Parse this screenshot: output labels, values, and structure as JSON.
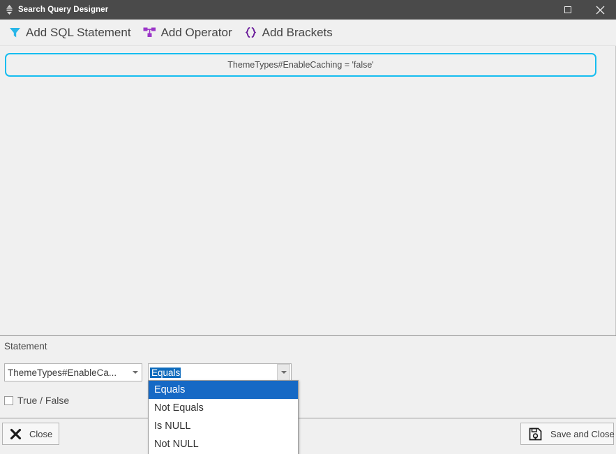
{
  "window": {
    "title": "Search Query Designer",
    "grip_icon": "move-vertical-icon",
    "maximize_icon": "maximize-icon",
    "close_icon": "close-icon",
    "accent_color": "#15bdf0",
    "titlebar_color": "#4a4a4a"
  },
  "toolbar": {
    "items": [
      {
        "label": "Add SQL Statement",
        "icon": "filter-funnel-icon",
        "icon_color": "#29b6e8",
        "name": "add-sql-statement"
      },
      {
        "label": "Add Operator",
        "icon": "operator-node-icon",
        "icon_color": "#9b36c8",
        "name": "add-operator"
      },
      {
        "label": "Add Brackets",
        "icon": "curly-brackets-icon",
        "icon_color": "#6a1b9a",
        "name": "add-brackets"
      }
    ]
  },
  "canvas": {
    "query_node": {
      "text": "ThemeTypes#EnableCaching = 'false'",
      "border_color": "#15bdf0"
    }
  },
  "statement_panel": {
    "title": "Statement",
    "field_combo": {
      "value": "ThemeTypes#EnableCa...",
      "arrow_icon": "chevron-down-icon"
    },
    "operator_combo": {
      "value": "Equals",
      "arrow_icon": "chevron-down-icon",
      "selection_color": "#0f6cbd"
    },
    "dropdown": {
      "open": true,
      "options": [
        "Equals",
        "Not Equals",
        "Is NULL",
        "Not NULL"
      ],
      "selected_index": 0,
      "highlight_color": "#1669c5"
    },
    "true_false_checkbox": {
      "label": "True / False",
      "checked": false
    }
  },
  "bottom_bar": {
    "close_button": {
      "label": "Close",
      "icon": "x-mark-icon"
    },
    "save_button": {
      "label": "Save and Close",
      "icon": "floppy-save-icon"
    }
  }
}
